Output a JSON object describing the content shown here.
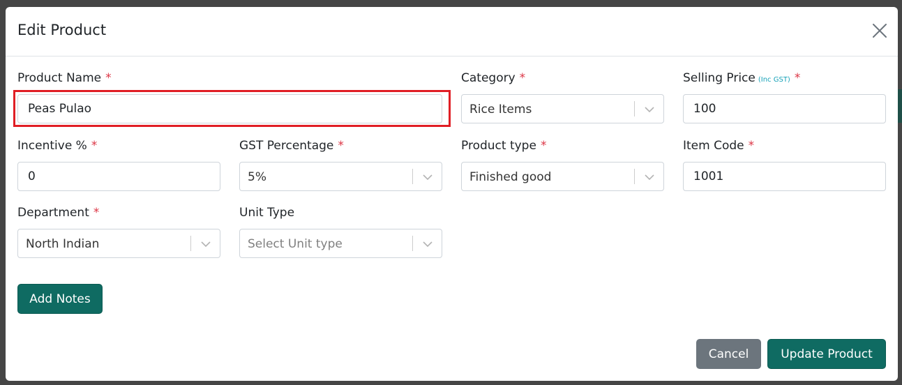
{
  "modal": {
    "title": "Edit Product"
  },
  "fields": {
    "product_name": {
      "label": "Product Name",
      "required": "*",
      "value": "Peas Pulao"
    },
    "category": {
      "label": "Category",
      "required": "*",
      "value": "Rice Items"
    },
    "selling_price": {
      "label": "Selling Price",
      "note": "(Inc GST)",
      "required": "*",
      "value": "100"
    },
    "incentive": {
      "label": "Incentive %",
      "required": "*",
      "value": "0"
    },
    "gst_percentage": {
      "label": "GST Percentage",
      "required": "*",
      "value": "5%"
    },
    "product_type": {
      "label": "Product type",
      "required": "*",
      "value": "Finished good"
    },
    "item_code": {
      "label": "Item Code",
      "required": "*",
      "value": "1001"
    },
    "department": {
      "label": "Department",
      "required": "*",
      "value": "North Indian"
    },
    "unit_type": {
      "label": "Unit Type",
      "placeholder": "Select Unit type"
    }
  },
  "buttons": {
    "add_notes": "Add Notes",
    "cancel": "Cancel",
    "update": "Update Product"
  },
  "colors": {
    "primary": "#0f6b62",
    "secondary": "#6c757d",
    "required": "#dc3545",
    "highlight": "#e01e25"
  },
  "icons": {
    "close": "close-icon",
    "dropdown": "chevron-down-icon"
  }
}
